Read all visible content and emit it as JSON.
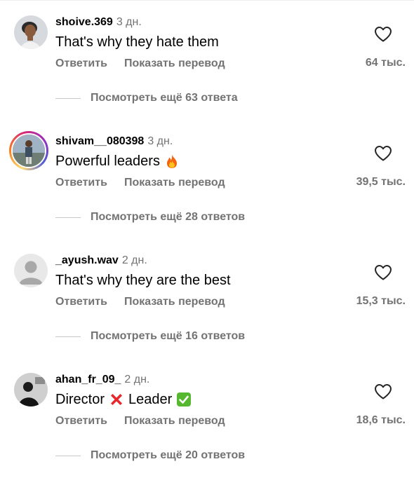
{
  "comments": [
    {
      "username": "shoive.369",
      "time": "3 дн.",
      "text": "That's why they hate them",
      "emoji": [],
      "reply_label": "Ответить",
      "translate_label": "Показать перевод",
      "likes": "64 тыс.",
      "more_replies": "Посмотреть ещё 63 ответа",
      "has_story": false,
      "avatar_icon": "profile-photo"
    },
    {
      "username": "shivam__080398",
      "time": "3 дн.",
      "text": "Powerful leaders",
      "emoji": [
        "fire"
      ],
      "reply_label": "Ответить",
      "translate_label": "Показать перевод",
      "likes": "39,5 тыс.",
      "more_replies": "Посмотреть ещё 28 ответов",
      "has_story": true,
      "avatar_icon": "profile-photo"
    },
    {
      "username": "_ayush.wav",
      "time": "2 дн.",
      "text": "That's why they are the best",
      "emoji": [],
      "reply_label": "Ответить",
      "translate_label": "Показать перевод",
      "likes": "15,3 тыс.",
      "more_replies": "Посмотреть ещё 16 ответов",
      "has_story": false,
      "avatar_icon": "default-avatar"
    },
    {
      "username": "ahan_fr_09_",
      "time": "2 дн.",
      "text_parts": [
        "Director",
        "Leader"
      ],
      "emoji": [
        "cross-mark",
        "check-mark"
      ],
      "reply_label": "Ответить",
      "translate_label": "Показать перевод",
      "likes": "18,6 тыс.",
      "more_replies": "Посмотреть ещё 20 ответов",
      "has_story": false,
      "avatar_icon": "profile-photo"
    }
  ],
  "colors": {
    "text": "#000000",
    "secondary": "#737373",
    "divider": "#c7c7c7",
    "background": "#ffffff"
  }
}
